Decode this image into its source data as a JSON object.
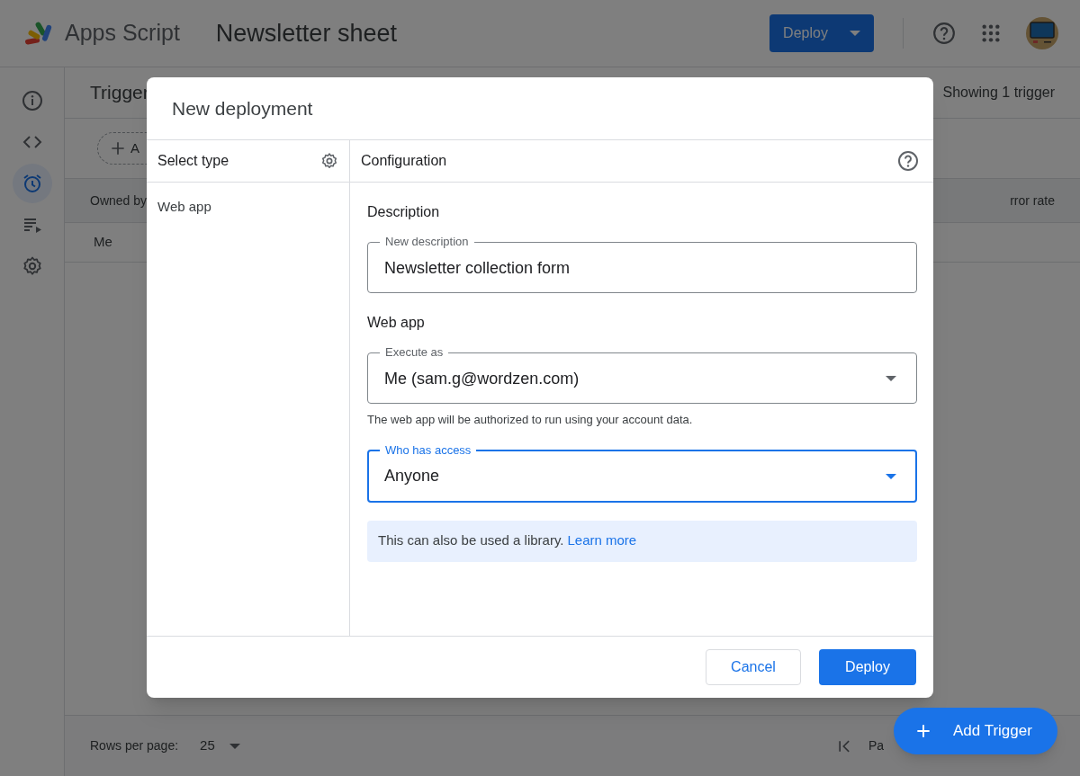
{
  "header": {
    "product_name": "Apps Script",
    "project_title": "Newsletter sheet",
    "deploy_button": "Deploy"
  },
  "sidebar": {
    "items": [
      {
        "kind": "info",
        "selected": false
      },
      {
        "kind": "code",
        "selected": false
      },
      {
        "kind": "triggers",
        "selected": true
      },
      {
        "kind": "executions",
        "selected": false
      },
      {
        "kind": "settings",
        "selected": false
      }
    ]
  },
  "triggers_page": {
    "title": "Trigger",
    "count": "Showing 1 trigger",
    "add_button": "A",
    "columns": [
      "Owned by",
      "rror rate"
    ],
    "rows": [
      [
        "Me"
      ]
    ],
    "footer": {
      "rows_per_page_label": "Rows per page:",
      "rows_per_page_value": "25",
      "page_label": "Pa"
    }
  },
  "dialog": {
    "title": "New deployment",
    "select_type_heading": "Select type",
    "types": [
      "Web app"
    ],
    "configuration_heading": "Configuration",
    "description_heading": "Description",
    "description_field": {
      "label": "New description",
      "value": "Newsletter collection form",
      "focused": false
    },
    "web_app_heading": "Web app",
    "execute_as": {
      "label": "Execute as",
      "value": "Me (sam.g@wordzen.com)",
      "focused": false
    },
    "execute_hint": "The web app will be authorized to run using your account data.",
    "who_has_access": {
      "label": "Who has access",
      "value": "Anyone",
      "focused": true
    },
    "info": {
      "text": "This can also be used a library.",
      "link": "Learn more"
    },
    "buttons": {
      "cancel": "Cancel",
      "deploy": "Deploy"
    }
  },
  "fab": {
    "label": "Add Trigger"
  }
}
